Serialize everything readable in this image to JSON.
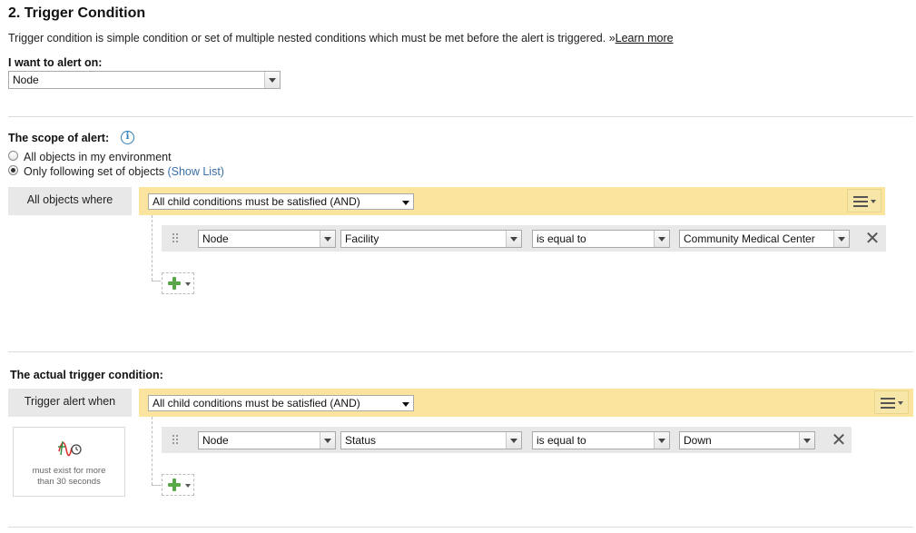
{
  "section": {
    "title": "2. Trigger Condition",
    "description": "Trigger condition is simple condition or set of multiple nested conditions which must be met before the alert is triggered.",
    "learn_more_prefix": "»",
    "learn_more": "Learn more"
  },
  "alert_on": {
    "label": "I want to alert on:",
    "value": "Node"
  },
  "scope": {
    "label": "The scope of alert:",
    "options": [
      {
        "label": "All objects in my environment",
        "selected": false
      },
      {
        "label": "Only following set of objects",
        "selected": true
      }
    ],
    "show_list": "(Show List)",
    "group_label": "All objects where",
    "group_operator": "All child conditions must be satisfied (AND)",
    "condition": {
      "object": "Node",
      "field": "Facility",
      "operator": "is equal to",
      "value": "Community Medical Center"
    }
  },
  "trigger": {
    "label": "The actual trigger condition:",
    "group_label": "Trigger alert when",
    "group_operator": "All child conditions must be satisfied (AND)",
    "condition": {
      "object": "Node",
      "field": "Status",
      "operator": "is equal to",
      "value": "Down"
    },
    "time_line1": "must exist for more",
    "time_line2": "than 30 seconds"
  },
  "colors": {
    "group_bar": "#fbe59e",
    "add_icon": "#58a84a",
    "info_icon": "#2d7fb8",
    "link": "#3a6ea5"
  }
}
